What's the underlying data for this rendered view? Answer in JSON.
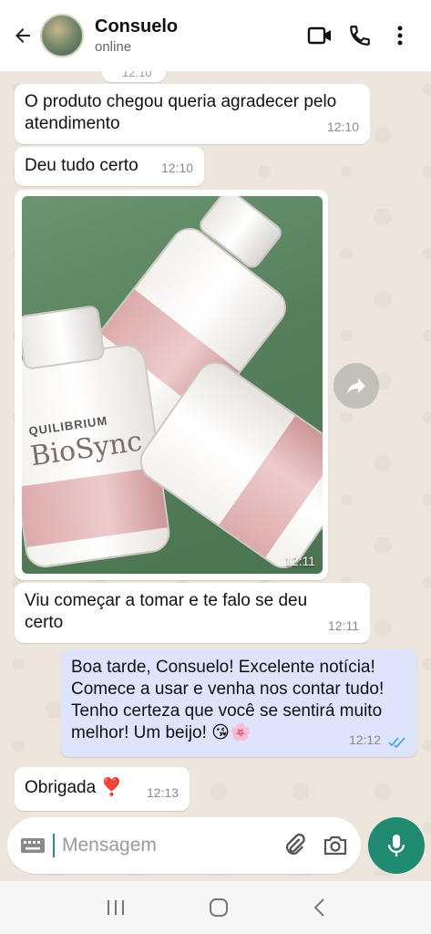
{
  "header": {
    "contact_name": "Consuelo",
    "status": "online"
  },
  "messages": {
    "prev_time": "12:10",
    "m1": {
      "text": "O produto chegou queria agradecer pelo atendimento",
      "time": "12:10"
    },
    "m2": {
      "text": "Deu tudo certo",
      "time": "12:10"
    },
    "m3": {
      "time": "12:11",
      "label_a": "QUILIBRIUM",
      "label_b": "BioSync"
    },
    "m4": {
      "text": "Viu começar a tomar e te falo se deu certo",
      "time": "12:11"
    },
    "m5": {
      "text": "Boa tarde,  Consuelo! Excelente notícia! Comece a usar e venha nos contar tudo! Tenho certeza que você se sentirá muito melhor! Um beijo! 😘🌸",
      "time": "12:12"
    },
    "m6": {
      "text": "Obrigada ❣️",
      "time": "12:13"
    }
  },
  "composer": {
    "placeholder": "Mensagem"
  },
  "colors": {
    "header_bg": "#ffffff",
    "chat_bg": "#ece6dd",
    "incoming_bubble": "#ffffff",
    "outgoing_bubble": "#dde4fb",
    "accent": "#1f8a70",
    "read_ticks": "#4fa8e0"
  },
  "icons": {
    "back": "arrow-left-icon",
    "video": "video-camera-icon",
    "call": "phone-icon",
    "menu": "more-vertical-icon",
    "forward": "forward-icon",
    "keyboard": "keyboard-icon",
    "attach": "paperclip-icon",
    "camera": "camera-icon",
    "mic": "microphone-icon"
  }
}
